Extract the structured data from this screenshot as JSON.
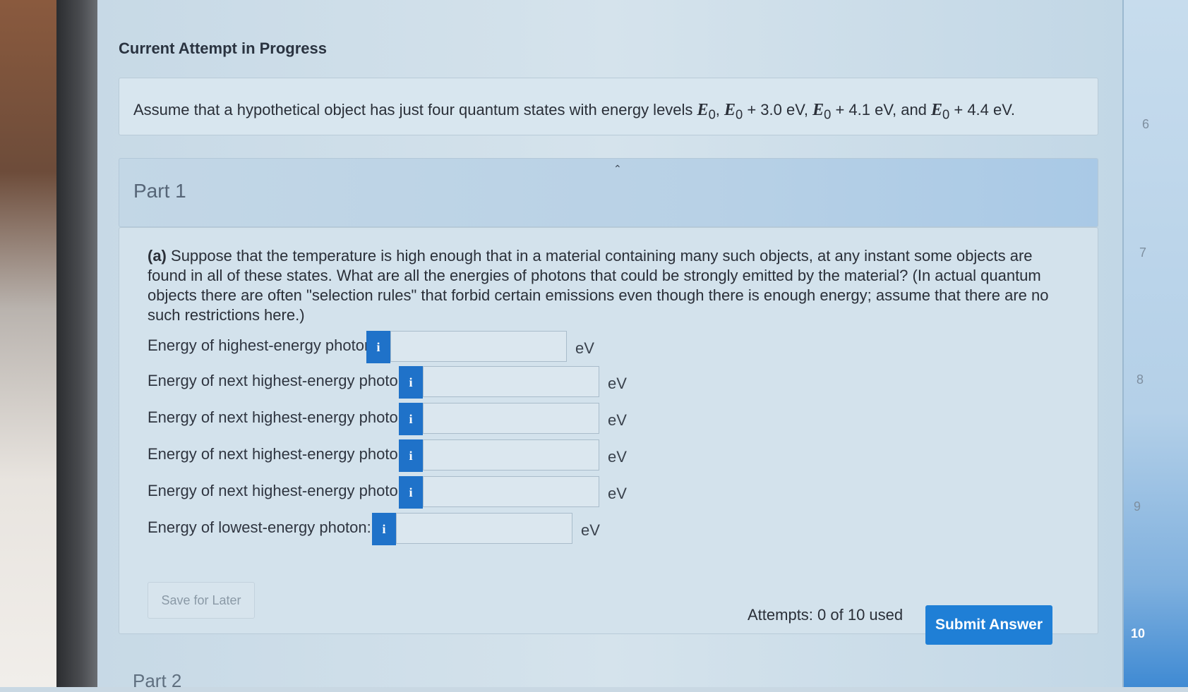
{
  "page": {
    "title": "Current Attempt in Progress"
  },
  "problem": {
    "prefix": "Assume that a hypothetical object has just four quantum states with energy levels ",
    "var_E0": "E",
    "sub0": "0",
    "levels": [
      ", ",
      " + 3.0 eV, ",
      " + 4.1 eV, and ",
      " + 4.4 eV."
    ]
  },
  "part1": {
    "title": "Part 1",
    "question_label": "(a)",
    "question_text": "Suppose that the temperature is high enough that in a material containing many such objects, at any instant some objects are found in all of these states. What are all the energies of photons that could be strongly emitted by the material? (In actual quantum objects there are often \"selection rules\" that forbid certain emissions even though there is enough energy; assume that there are no such restrictions here.)",
    "info_icon": "i",
    "unit": "eV",
    "rows": [
      {
        "label": "Energy of highest-energy photon:",
        "value": ""
      },
      {
        "label": "Energy of next highest-energy photon:",
        "value": ""
      },
      {
        "label": "Energy of next highest-energy photon:",
        "value": ""
      },
      {
        "label": "Energy of next highest-energy photon:",
        "value": ""
      },
      {
        "label": "Energy of next highest-energy photon:",
        "value": ""
      },
      {
        "label": "Energy of lowest-energy photon:",
        "value": ""
      }
    ],
    "save_label": "Save for Later",
    "attempts": "Attempts: 0 of 10 used",
    "submit_label": "Submit Answer"
  },
  "part2": {
    "title": "Part 2"
  },
  "sidebar": {
    "numbers": [
      "6",
      "7",
      "8",
      "9",
      "10"
    ],
    "active": "10"
  },
  "colors": {
    "accent": "#1f7fd6",
    "info_button": "#1f72c9"
  }
}
